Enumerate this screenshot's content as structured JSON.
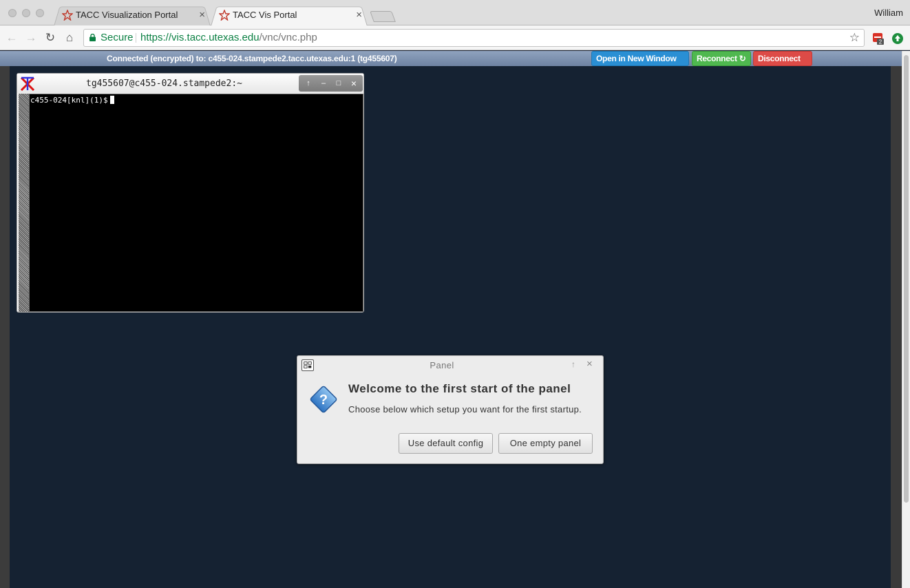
{
  "browser": {
    "tabs": [
      {
        "title": "TACC Visualization Portal",
        "active": false
      },
      {
        "title": "TACC Vis Portal",
        "active": true
      }
    ],
    "tab_close_glyph": "×",
    "profile_name": "William",
    "nav": {
      "back_icon": "back-arrow-icon",
      "forward_icon": "forward-arrow-icon",
      "reload_icon": "reload-icon",
      "home_icon": "home-icon"
    },
    "address": {
      "secure_label": "Secure",
      "url_host": "https://vis.tacc.utexas.edu",
      "url_path": "/vnc/vnc.php"
    },
    "extension_badge": "2"
  },
  "vnc": {
    "status_text": "Connected (encrypted) to: c455-024.stampede2.tacc.utexas.edu:1 (tg455607)",
    "buttons": {
      "open_new_window": "Open in New Window",
      "reconnect": "Reconnect",
      "disconnect": "Disconnect"
    }
  },
  "xterm": {
    "title": "tg455607@c455-024.stampede2:~",
    "prompt": "c455-024[knl](1)$"
  },
  "panel_dialog": {
    "title": "Panel",
    "heading": "Welcome to the first start of the panel",
    "message": "Choose below which setup you want for the first startup.",
    "buttons": {
      "default_config": "Use default config",
      "empty_panel": "One empty panel"
    }
  },
  "colors": {
    "secure_green": "#0b8043",
    "reconnect_green": "#4fb84f",
    "disconnect_red": "#dd4b47",
    "open_blue": "#2a8fd4",
    "desktop_bg": "#152232"
  }
}
